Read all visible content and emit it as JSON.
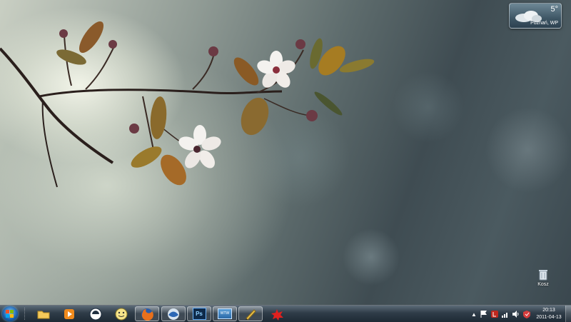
{
  "weather_gadget": {
    "temperature": "5°",
    "location": "Poznań, WP",
    "condition_icon": "cloudy-icon"
  },
  "desktop_icons": [
    {
      "label": "Kosz",
      "icon": "recycle-bin-icon"
    }
  ],
  "taskbar": {
    "start_icon": "windows-logo-icon",
    "pinned": [
      {
        "name": "explorer",
        "icon": "folder-icon",
        "running": false
      },
      {
        "name": "media-player",
        "icon": "media-player-icon",
        "running": false
      },
      {
        "name": "chat-app",
        "icon": "chat-bubble-icon",
        "running": false
      },
      {
        "name": "gadu",
        "icon": "smiley-icon",
        "running": false
      },
      {
        "name": "firefox",
        "icon": "firefox-icon",
        "running": true
      },
      {
        "name": "thunderbird",
        "icon": "thunderbird-icon",
        "running": true
      },
      {
        "name": "photoshop",
        "icon": "photoshop-icon",
        "running": true
      },
      {
        "name": "wtw",
        "icon": "window-icon",
        "running": true
      },
      {
        "name": "tool",
        "icon": "brush-icon",
        "running": true
      },
      {
        "name": "splat",
        "icon": "red-splat-icon",
        "running": false
      }
    ],
    "photoshop_label": "Ps",
    "wtw_label": "WTW",
    "tray_icons": [
      "show-hidden-icon",
      "flag-icon",
      "antivirus-icon",
      "network-icon",
      "volume-icon",
      "security-icon"
    ],
    "clock": {
      "time": "20:13",
      "date": "2011-04-13"
    }
  },
  "colors": {
    "taskbar": "#2f3c48",
    "accent": "#1b5fa8"
  }
}
